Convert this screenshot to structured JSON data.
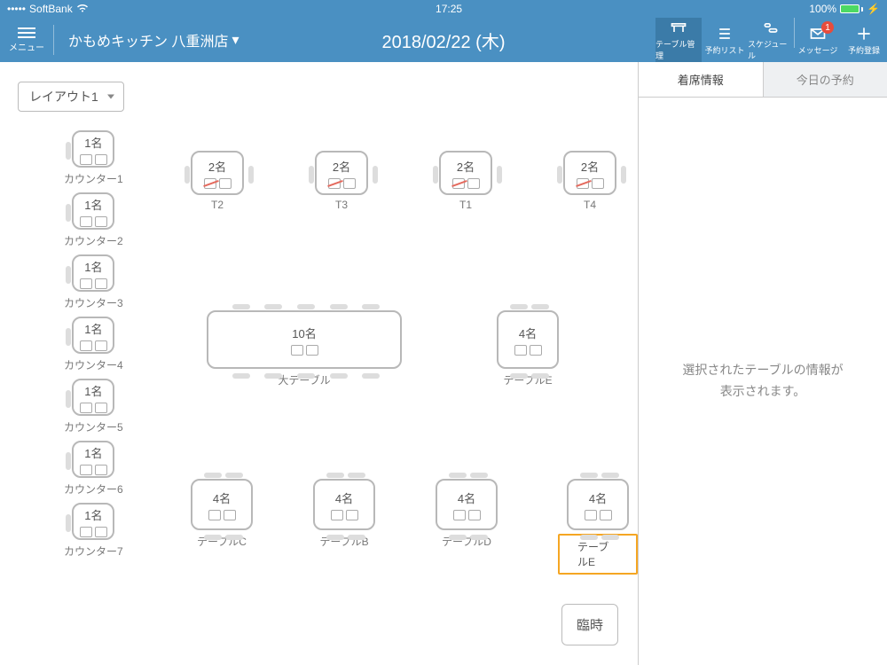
{
  "status": {
    "carrier": "SoftBank",
    "time": "17:25",
    "battery": "100%"
  },
  "topbar": {
    "menu_label": "メニュー",
    "store_name": "かもめキッチン 八重洲店",
    "date_title": "2018/02/22 (木)",
    "icons": {
      "table_mgmt": "テーブル管理",
      "reserve_list": "予約リスト",
      "schedule": "スケジュール",
      "messages": "メッセージ",
      "add_reserve": "予約登録"
    },
    "msg_badge": "1"
  },
  "layout_selector": "レイアウト1",
  "counters": [
    {
      "label": "カウンター1",
      "capacity": "1名"
    },
    {
      "label": "カウンター2",
      "capacity": "1名"
    },
    {
      "label": "カウンター3",
      "capacity": "1名"
    },
    {
      "label": "カウンター4",
      "capacity": "1名"
    },
    {
      "label": "カウンター5",
      "capacity": "1名"
    },
    {
      "label": "カウンター6",
      "capacity": "1名"
    },
    {
      "label": "カウンター7",
      "capacity": "1名"
    }
  ],
  "small_tables": [
    {
      "label": "T2",
      "capacity": "2名"
    },
    {
      "label": "T3",
      "capacity": "2名"
    },
    {
      "label": "T1",
      "capacity": "2名"
    },
    {
      "label": "T4",
      "capacity": "2名"
    }
  ],
  "big_table": {
    "label": "大テーブル",
    "capacity": "10名"
  },
  "mid_table": {
    "label": "テーブルE",
    "capacity": "4名"
  },
  "bottom_tables": [
    {
      "label": "テーブルC",
      "capacity": "4名"
    },
    {
      "label": "テーブルB",
      "capacity": "4名"
    },
    {
      "label": "テーブルD",
      "capacity": "4名"
    },
    {
      "label": "テーブルE",
      "capacity": "4名",
      "highlight": true
    }
  ],
  "temp_button": "臨時",
  "side": {
    "tab_seat": "着席情報",
    "tab_today": "今日の予約",
    "empty_msg": "選択されたテーブルの情報が\n表示されます。"
  }
}
